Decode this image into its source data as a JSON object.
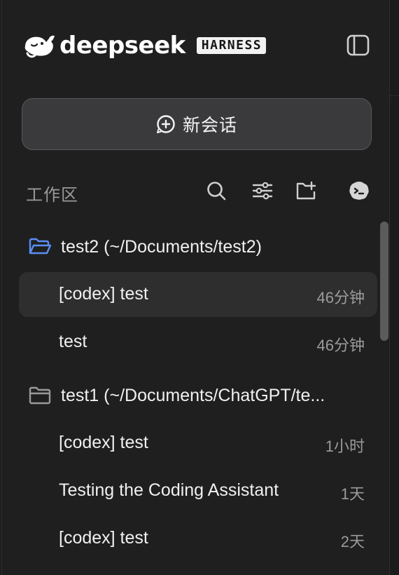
{
  "brand": {
    "wordmark": "deepseek",
    "badge": "HARNESS"
  },
  "new_chat": {
    "label": "新会话",
    "icon": "plus-circle-icon"
  },
  "workspace": {
    "label": "工作区",
    "actions": [
      {
        "name": "search-icon"
      },
      {
        "name": "filter-icon"
      },
      {
        "name": "new-folder-icon"
      },
      {
        "name": "terminal-icon"
      }
    ]
  },
  "groups": [
    {
      "folder": "test2 (~/Documents/test2)",
      "folder_color": "#5b8ff5",
      "items": [
        {
          "title": "[codex] test",
          "time": "46分钟",
          "active": true
        },
        {
          "title": "test",
          "time": "46分钟",
          "active": false
        }
      ]
    },
    {
      "folder": "test1 (~/Documents/ChatGPT/te...",
      "folder_color": "#9a9a9a",
      "items": [
        {
          "title": "[codex] test",
          "time": "1小时",
          "active": false
        },
        {
          "title": "Testing the Coding Assistant",
          "time": "1天",
          "active": false
        },
        {
          "title": "[codex] test",
          "time": "2天",
          "active": false
        }
      ]
    }
  ],
  "colors": {
    "background": "#1f1f1f",
    "active_row": "#2e2e2f",
    "button": "#3a3a3c",
    "muted_text": "#9b9b9b"
  }
}
